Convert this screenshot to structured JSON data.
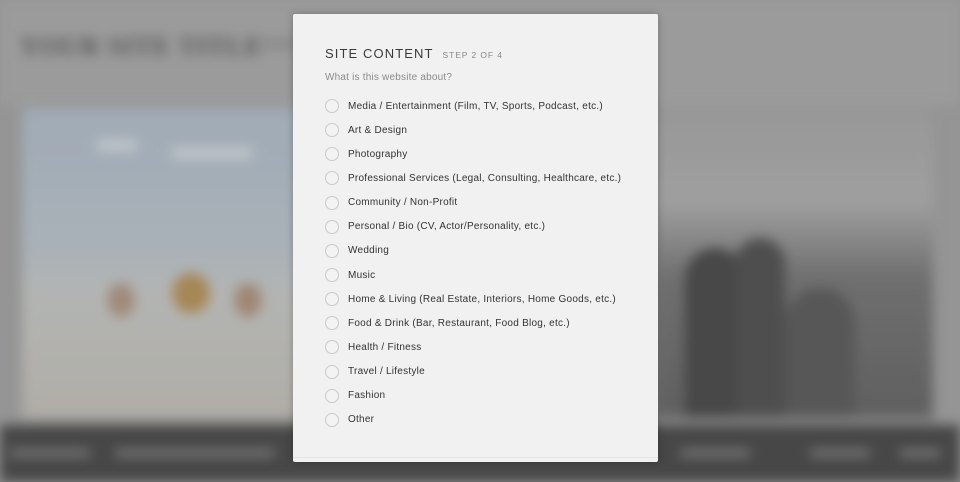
{
  "background": {
    "site_title": "YOUR SITE TITLE"
  },
  "modal": {
    "title": "SITE CONTENT",
    "step": "STEP 2 OF 4",
    "question": "What is this website about?",
    "options": [
      {
        "label": "Media / Entertainment (Film, TV, Sports, Podcast, etc.)",
        "selected": false
      },
      {
        "label": "Art & Design",
        "selected": false
      },
      {
        "label": "Photography",
        "selected": false
      },
      {
        "label": "Professional Services (Legal, Consulting, Healthcare, etc.)",
        "selected": false
      },
      {
        "label": "Community / Non-Profit",
        "selected": false
      },
      {
        "label": "Personal / Bio (CV, Actor/Personality, etc.)",
        "selected": false
      },
      {
        "label": "Wedding",
        "selected": false
      },
      {
        "label": "Music",
        "selected": false
      },
      {
        "label": "Home & Living (Real Estate, Interiors, Home Goods, etc.)",
        "selected": false
      },
      {
        "label": "Food & Drink (Bar, Restaurant, Food Blog, etc.)",
        "selected": false
      },
      {
        "label": "Health / Fitness",
        "selected": false
      },
      {
        "label": "Travel / Lifestyle",
        "selected": false
      },
      {
        "label": "Fashion",
        "selected": false
      },
      {
        "label": "Other",
        "selected": false
      }
    ]
  },
  "colors": {
    "modal_bg": "#f1f1f1",
    "title": "#3a3a3a",
    "muted": "#8a8a8a",
    "radio_border": "#c9c9c9"
  }
}
